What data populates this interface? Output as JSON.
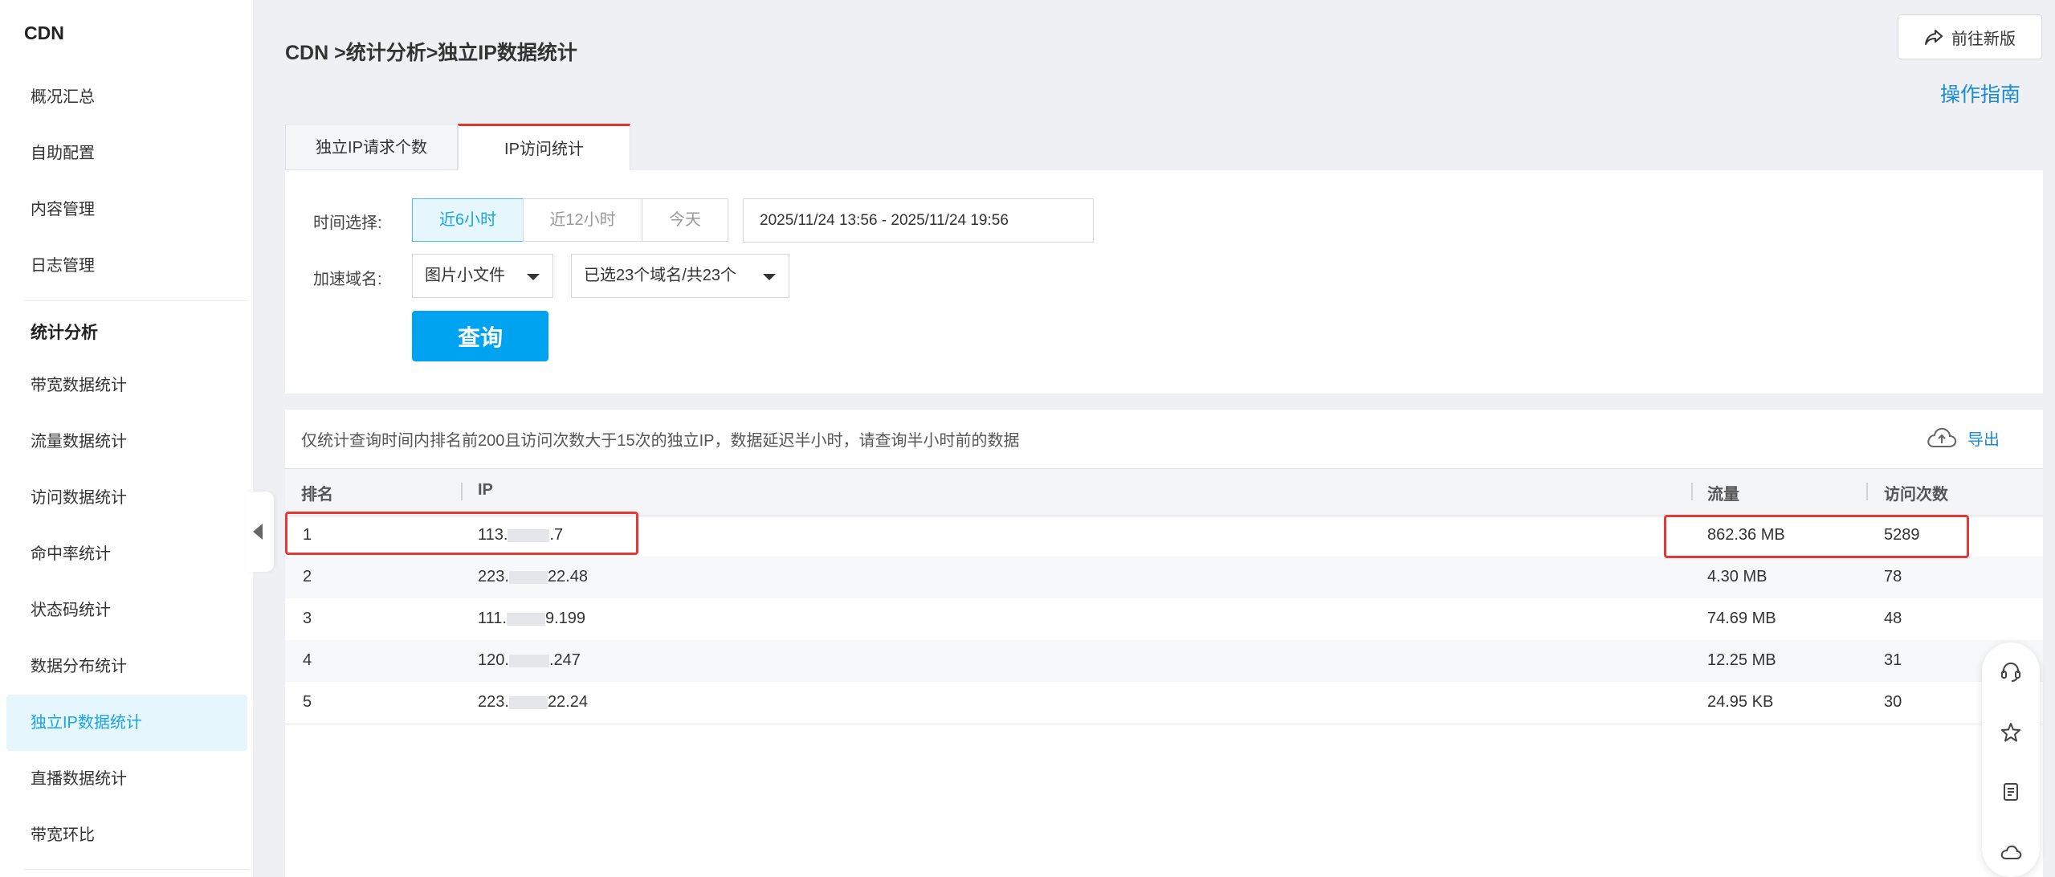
{
  "sidebar": {
    "title": "CDN",
    "items_top": [
      "概况汇总",
      "自助配置",
      "内容管理",
      "日志管理"
    ],
    "group_title": "统计分析",
    "items_stats": [
      "带宽数据统计",
      "流量数据统计",
      "访问数据统计",
      "命中率统计",
      "状态码统计",
      "数据分布统计",
      "独立IP数据统计",
      "直播数据统计",
      "带宽环比"
    ],
    "active_item": "独立IP数据统计"
  },
  "header": {
    "breadcrumb": "CDN >统计分析>独立IP数据统计",
    "new_version_label": "前往新版",
    "guide_label": "操作指南"
  },
  "tabs": [
    "独立IP请求个数",
    "IP访问统计"
  ],
  "filters": {
    "time_label": "时间选择:",
    "time_options": [
      "近6小时",
      "近12小时",
      "今天"
    ],
    "time_selected": "近6小时",
    "date_range": "2025/11/24 13:56 - 2025/11/24 19:56",
    "domain_label": "加速域名:",
    "domain_type": "图片小文件",
    "domain_selection": "已选23个域名/共23个",
    "query_label": "查询"
  },
  "result": {
    "notice": "仅统计查询时间内排名前200且访问次数大于15次的独立IP，数据延迟半小时，请查询半小时前的数据",
    "export_label": "导出",
    "columns": [
      "排名",
      "IP",
      "流量",
      "访问次数"
    ],
    "rows": [
      {
        "rank": "1",
        "ip_prefix": "113.",
        "ip_suffix": ".7",
        "traffic": "862.36 MB",
        "visits": "5289"
      },
      {
        "rank": "2",
        "ip_prefix": "223.",
        "ip_suffix": "22.48",
        "traffic": "4.30 MB",
        "visits": "78"
      },
      {
        "rank": "3",
        "ip_prefix": "111.",
        "ip_suffix": "9.199",
        "traffic": "74.69 MB",
        "visits": "48"
      },
      {
        "rank": "4",
        "ip_prefix": "120.",
        "ip_suffix": ".247",
        "traffic": "12.25 MB",
        "visits": "31"
      },
      {
        "rank": "5",
        "ip_prefix": "223.",
        "ip_suffix": "22.24",
        "traffic": "24.95 KB",
        "visits": "30"
      }
    ]
  },
  "float_toolbar": [
    "headset-icon",
    "star-icon",
    "document-icon",
    "cloud-icon"
  ],
  "colors": {
    "accent": "#00a3f0",
    "link": "#1a8bd6",
    "highlight_box": "#e53935",
    "active_tab_border": "#e8322c"
  }
}
